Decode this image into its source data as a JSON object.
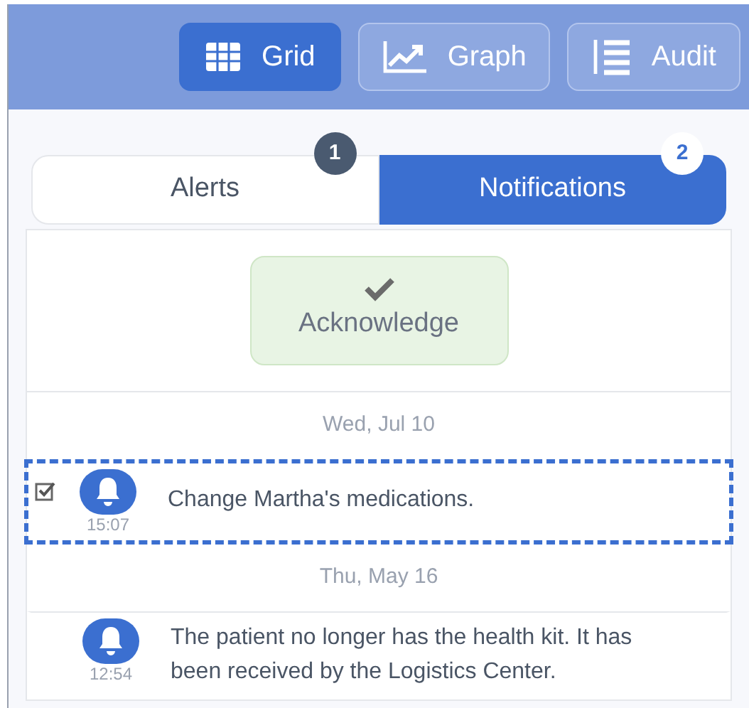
{
  "toolbar": {
    "buttons": [
      {
        "label": "Grid",
        "selected": true
      },
      {
        "label": "Graph",
        "selected": false
      },
      {
        "label": "Audit",
        "selected": false
      }
    ]
  },
  "tabs": [
    {
      "label": "Alerts",
      "badge": "1",
      "selected": false
    },
    {
      "label": "Notifications",
      "badge": "2",
      "selected": true
    }
  ],
  "acknowledge_button": {
    "label": "Acknowledge"
  },
  "groups": [
    {
      "date": "Wed, Jul 10",
      "items": [
        {
          "text": "Change Martha's medications.",
          "time": "15:07",
          "checked": true,
          "selected": true
        }
      ]
    },
    {
      "date": "Thu, May 16",
      "items": [
        {
          "text": "The patient no longer has the health kit. It has been received by the Logistics Center.",
          "time": "12:54",
          "checked": false,
          "selected": false
        }
      ]
    }
  ]
}
